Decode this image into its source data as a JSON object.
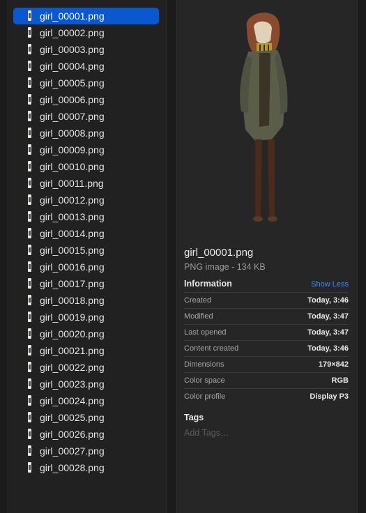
{
  "files": [
    "girl_00001.png",
    "girl_00002.png",
    "girl_00003.png",
    "girl_00004.png",
    "girl_00005.png",
    "girl_00006.png",
    "girl_00007.png",
    "girl_00008.png",
    "girl_00009.png",
    "girl_00010.png",
    "girl_00011.png",
    "girl_00012.png",
    "girl_00013.png",
    "girl_00014.png",
    "girl_00015.png",
    "girl_00016.png",
    "girl_00017.png",
    "girl_00018.png",
    "girl_00019.png",
    "girl_00020.png",
    "girl_00021.png",
    "girl_00022.png",
    "girl_00023.png",
    "girl_00024.png",
    "girl_00025.png",
    "girl_00026.png",
    "girl_00027.png",
    "girl_00028.png"
  ],
  "selected_index": 0,
  "preview": {
    "title": "girl_00001.png",
    "subtitle": "PNG image - 134 KB",
    "information_label": "Information",
    "show_less": "Show Less",
    "info": [
      {
        "key": "Created",
        "value": "Today, 3:46"
      },
      {
        "key": "Modified",
        "value": "Today, 3:47"
      },
      {
        "key": "Last opened",
        "value": "Today, 3:47"
      },
      {
        "key": "Content created",
        "value": "Today, 3:46"
      },
      {
        "key": "Dimensions",
        "value": "179×842"
      },
      {
        "key": "Color space",
        "value": "RGB"
      },
      {
        "key": "Color profile",
        "value": "Display P3"
      }
    ],
    "tags_label": "Tags",
    "tags_placeholder": "Add Tags…"
  },
  "colors": {
    "selection": "#0a58d0",
    "link": "#3d8ef7"
  }
}
